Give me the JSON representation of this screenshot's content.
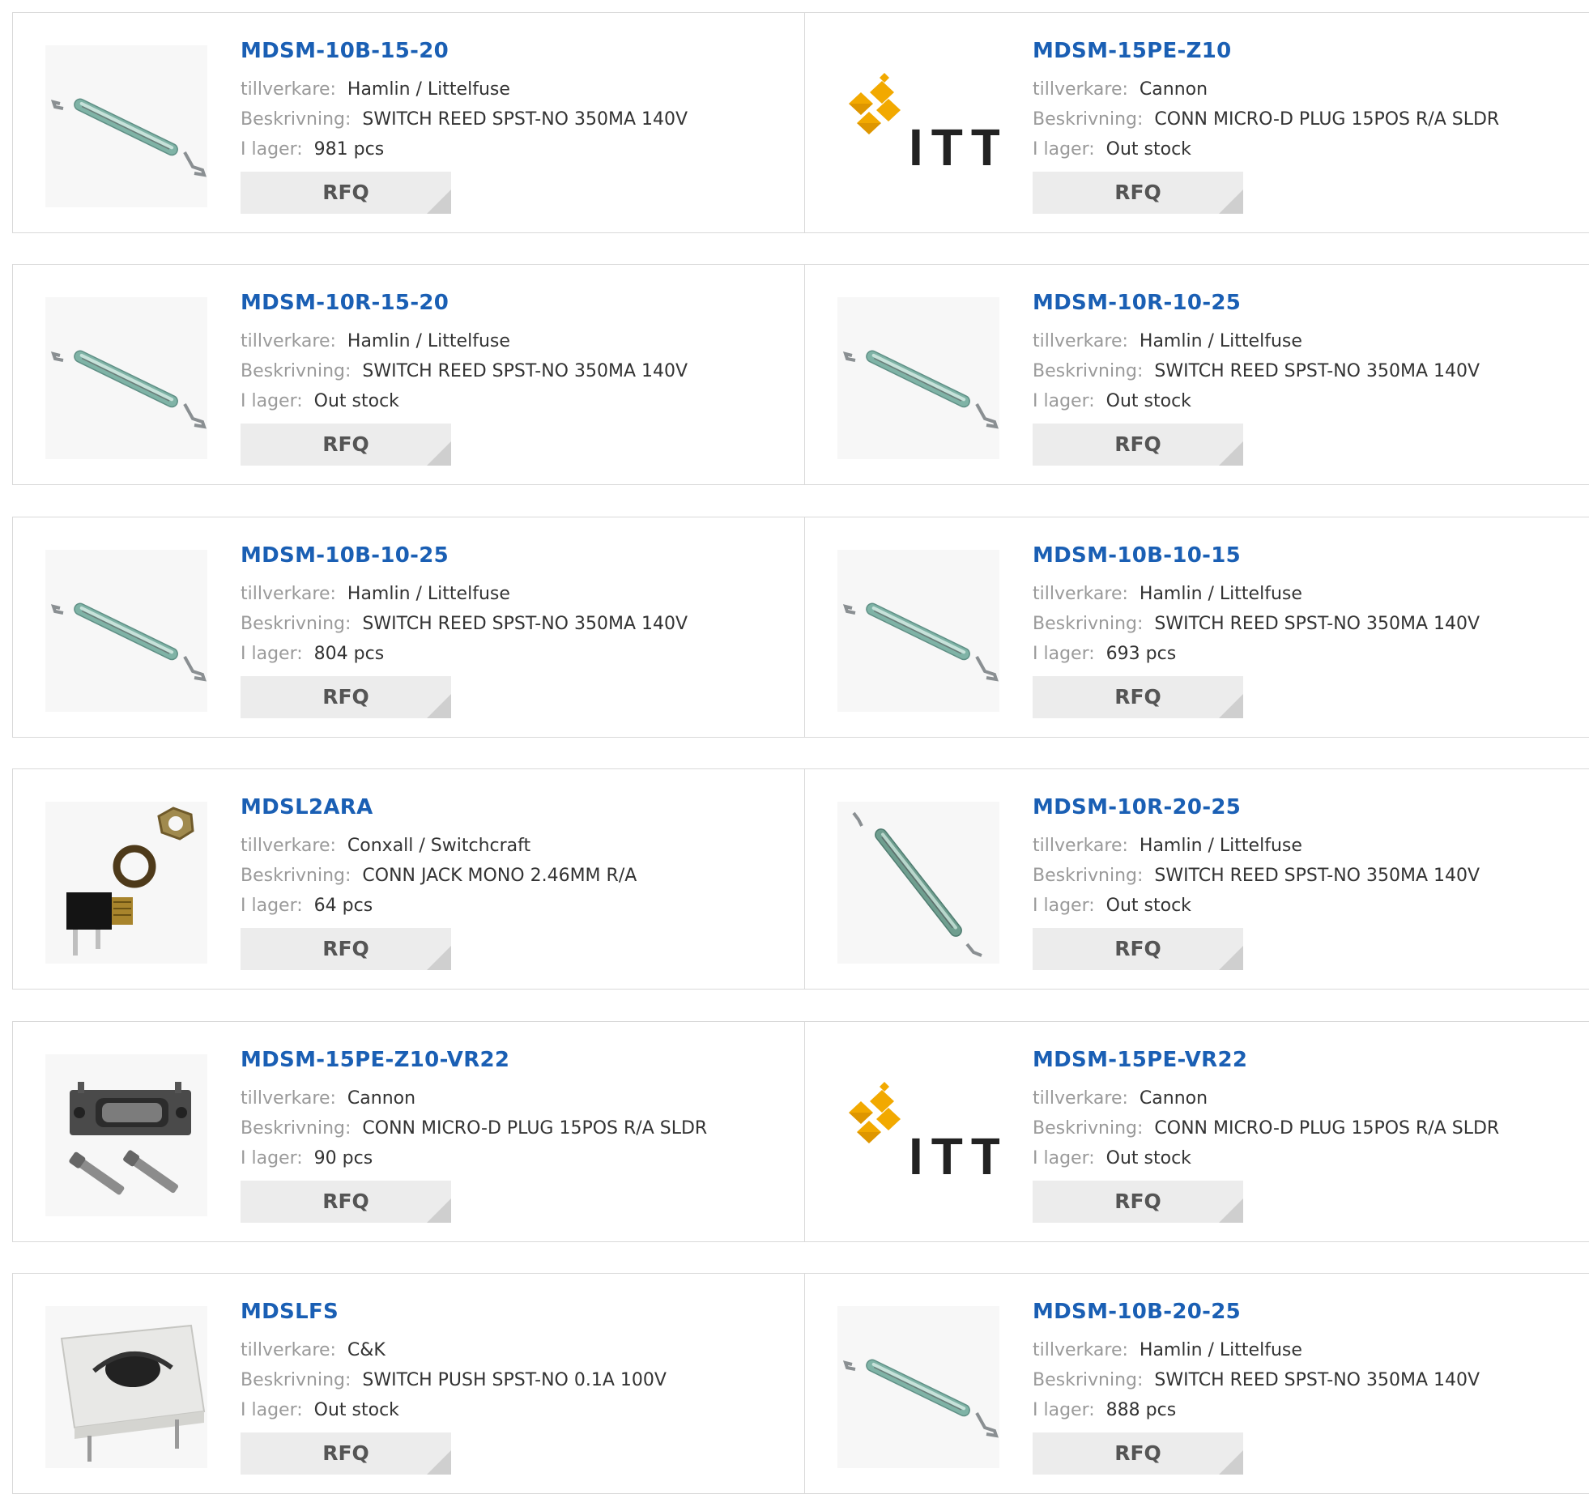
{
  "labels": {
    "manufacturer": "tillverkare:",
    "description": "Beskrivning:",
    "stock": "I lager:",
    "rfq": "RFQ"
  },
  "colors": {
    "part_number": "#1a5fb4",
    "label": "#9a9a9a",
    "value": "#333333",
    "rfq_bg": "#ececec"
  },
  "products": [
    {
      "part": "MDSM-10B-15-20",
      "manufacturer": "Hamlin / Littelfuse",
      "description": "SWITCH REED SPST-NO 350MA 140V",
      "stock": "981 pcs",
      "image": "reed-switch-icon"
    },
    {
      "part": "MDSM-15PE-Z10",
      "manufacturer": "Cannon",
      "description": "CONN MICRO-D PLUG 15POS R/A SLDR",
      "stock": "Out stock",
      "image": "itt-logo"
    },
    {
      "part": "MDSM-10R-15-20",
      "manufacturer": "Hamlin / Littelfuse",
      "description": "SWITCH REED SPST-NO 350MA 140V",
      "stock": "Out stock",
      "image": "reed-switch-icon"
    },
    {
      "part": "MDSM-10R-10-25",
      "manufacturer": "Hamlin / Littelfuse",
      "description": "SWITCH REED SPST-NO 350MA 140V",
      "stock": "Out stock",
      "image": "reed-switch-icon"
    },
    {
      "part": "MDSM-10B-10-25",
      "manufacturer": "Hamlin / Littelfuse",
      "description": "SWITCH REED SPST-NO 350MA 140V",
      "stock": "804 pcs",
      "image": "reed-switch-icon"
    },
    {
      "part": "MDSM-10B-10-15",
      "manufacturer": "Hamlin / Littelfuse",
      "description": "SWITCH REED SPST-NO 350MA 140V",
      "stock": "693 pcs",
      "image": "reed-switch-icon"
    },
    {
      "part": "MDSL2ARA",
      "manufacturer": "Conxall / Switchcraft",
      "description": "CONN JACK MONO 2.46MM R/A",
      "stock": "64 pcs",
      "image": "audio-jack-icon"
    },
    {
      "part": "MDSM-10R-20-25",
      "manufacturer": "Hamlin / Littelfuse",
      "description": "SWITCH REED SPST-NO 350MA 140V",
      "stock": "Out stock",
      "image": "reed-switch-diagonal-icon"
    },
    {
      "part": "MDSM-15PE-Z10-VR22",
      "manufacturer": "Cannon",
      "description": "CONN MICRO-D PLUG 15POS R/A SLDR",
      "stock": "90 pcs",
      "image": "micro-d-connector-icon"
    },
    {
      "part": "MDSM-15PE-VR22",
      "manufacturer": "Cannon",
      "description": "CONN MICRO-D PLUG 15POS R/A SLDR",
      "stock": "Out stock",
      "image": "itt-logo"
    },
    {
      "part": "MDSLFS",
      "manufacturer": "C&K",
      "description": "SWITCH PUSH SPST-NO 0.1A 100V",
      "stock": "Out stock",
      "image": "push-switch-icon"
    },
    {
      "part": "MDSM-10B-20-25",
      "manufacturer": "Hamlin / Littelfuse",
      "description": "SWITCH REED SPST-NO 350MA 140V",
      "stock": "888 pcs",
      "image": "reed-switch-icon"
    }
  ]
}
